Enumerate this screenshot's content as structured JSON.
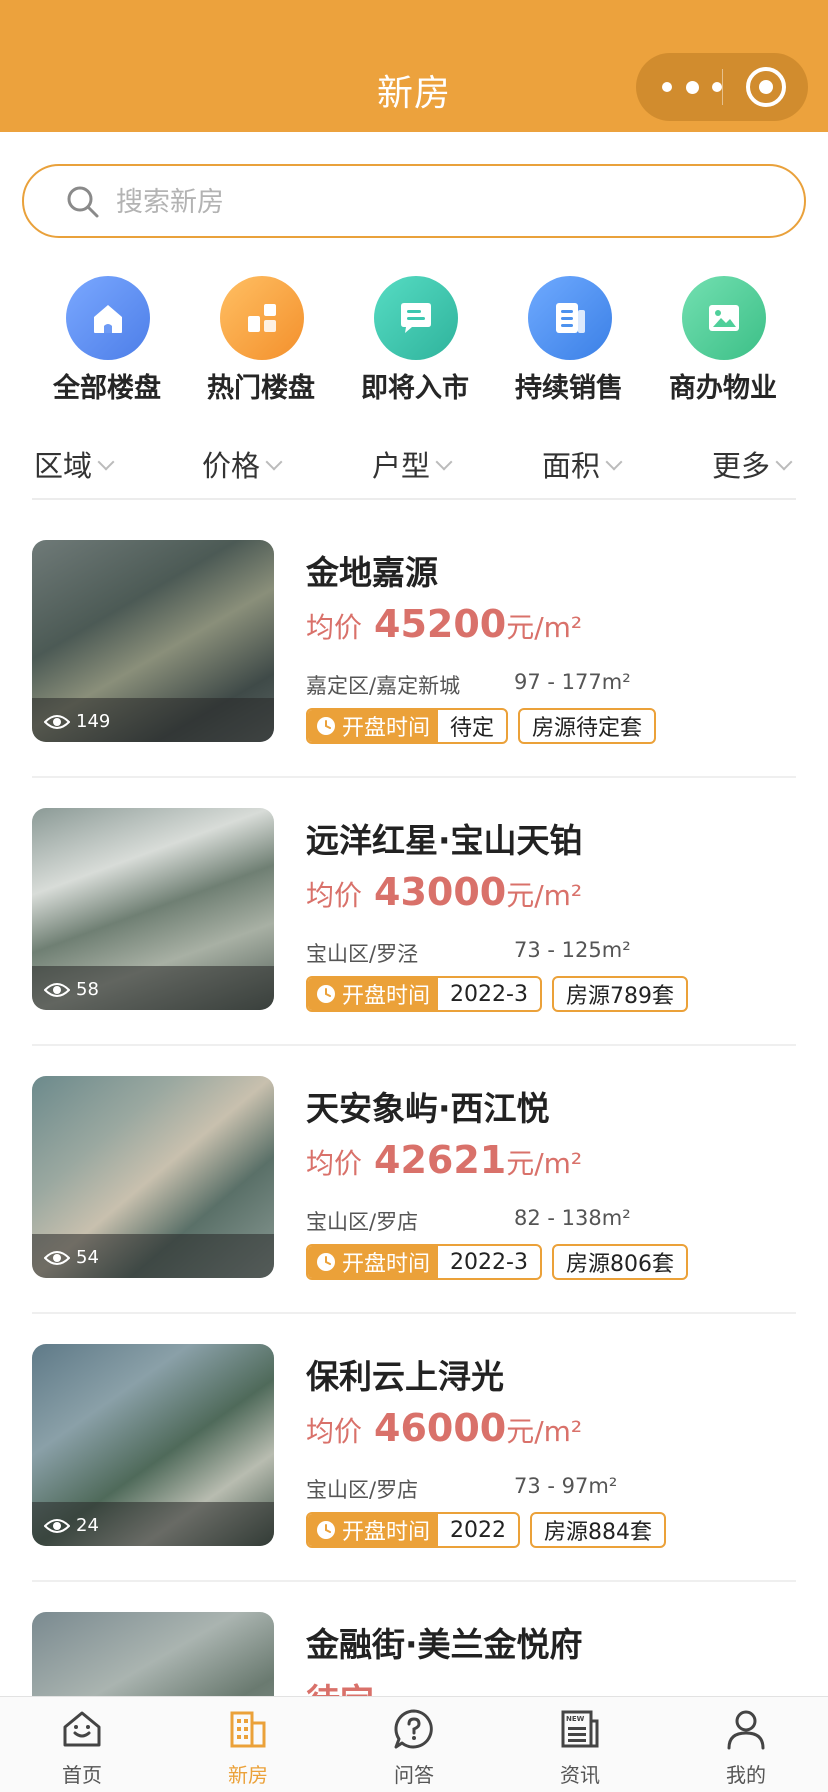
{
  "header": {
    "title": "新房"
  },
  "search": {
    "placeholder": "搜索新房"
  },
  "categories": [
    {
      "label": "全部楼盘",
      "icon": "house-icon",
      "color": "#5b8ff0"
    },
    {
      "label": "热门楼盘",
      "icon": "blocks-icon",
      "color": "#f5a13b"
    },
    {
      "label": "即将入市",
      "icon": "chat-icon",
      "color": "#3cc7b0"
    },
    {
      "label": "持续销售",
      "icon": "document-icon",
      "color": "#4d92ee"
    },
    {
      "label": "商办物业",
      "icon": "image-icon",
      "color": "#4fcf9a"
    }
  ],
  "filters": [
    "区域",
    "价格",
    "户型",
    "面积",
    "更多"
  ],
  "listing_labels": {
    "price_prefix": "均价",
    "price_unit": "元/m²",
    "open_label": "开盘时间"
  },
  "listings": [
    {
      "title": "金地嘉源",
      "price": "45200",
      "location": "嘉定区/嘉定新城",
      "area": "97 - 177m²",
      "open_time": "待定",
      "stock": "房源待定套",
      "views": "149"
    },
    {
      "title": "远洋红星·宝山天铂",
      "price": "43000",
      "location": "宝山区/罗泾",
      "area": "73 - 125m²",
      "open_time": "2022-3",
      "stock": "房源789套",
      "views": "58"
    },
    {
      "title": "天安象屿·西江悦",
      "price": "42621",
      "location": "宝山区/罗店",
      "area": "82 - 138m²",
      "open_time": "2022-3",
      "stock": "房源806套",
      "views": "54"
    },
    {
      "title": "保利云上浔光",
      "price": "46000",
      "location": "宝山区/罗店",
      "area": "73 - 97m²",
      "open_time": "2022",
      "stock": "房源884套",
      "views": "24"
    },
    {
      "title": "金融街·美兰金悦府",
      "price_partial": "待定"
    }
  ],
  "tabbar": [
    {
      "label": "首页",
      "icon": "home-smile-icon"
    },
    {
      "label": "新房",
      "icon": "building-icon",
      "active": true
    },
    {
      "label": "问答",
      "icon": "question-bubble-icon"
    },
    {
      "label": "资讯",
      "icon": "news-icon",
      "badge": "NEW"
    },
    {
      "label": "我的",
      "icon": "person-icon"
    }
  ],
  "colors": {
    "brand": "#eca23d",
    "price": "#d9716a"
  }
}
